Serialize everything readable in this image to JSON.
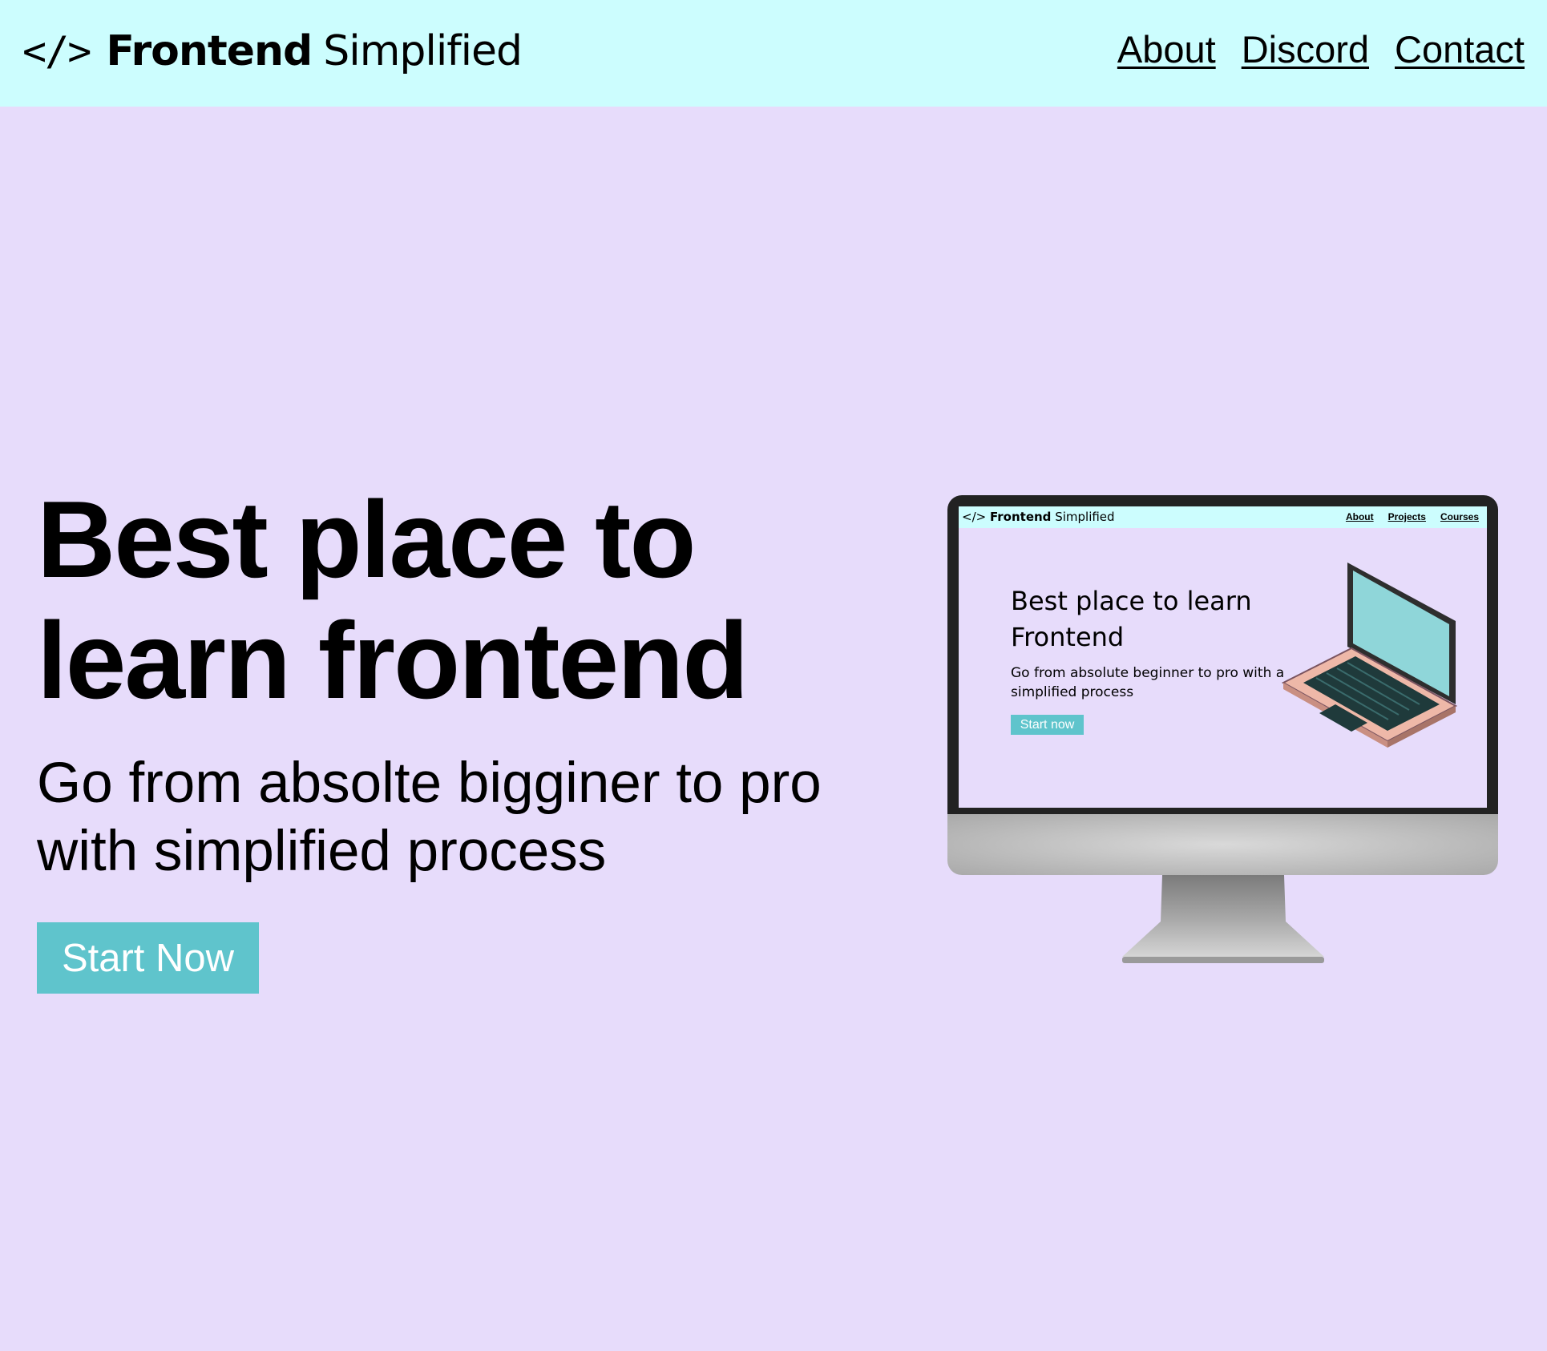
{
  "header": {
    "logo_icon": "</>",
    "logo_bold": "Frontend",
    "logo_light": "Simplified",
    "nav": [
      "About",
      "Discord",
      "Contact"
    ]
  },
  "hero": {
    "title": "Best place to learn frontend",
    "subtitle": "Go from absolte bigginer to pro with simplified process",
    "cta_label": "Start Now"
  },
  "illustration": {
    "mini_logo_icon": "</>",
    "mini_logo_bold": "Frontend",
    "mini_logo_light": "Simplified",
    "mini_nav": [
      "About",
      "Projects",
      "Courses"
    ],
    "mini_title": "Best place to learn Frontend",
    "mini_subtitle": "Go from absolute beginner to pro with a simplified process",
    "mini_cta": "Start now"
  },
  "colors": {
    "nav_bg": "#ccfdfe",
    "page_bg": "#e7dcfb",
    "cta_bg": "#5fc4cc"
  }
}
